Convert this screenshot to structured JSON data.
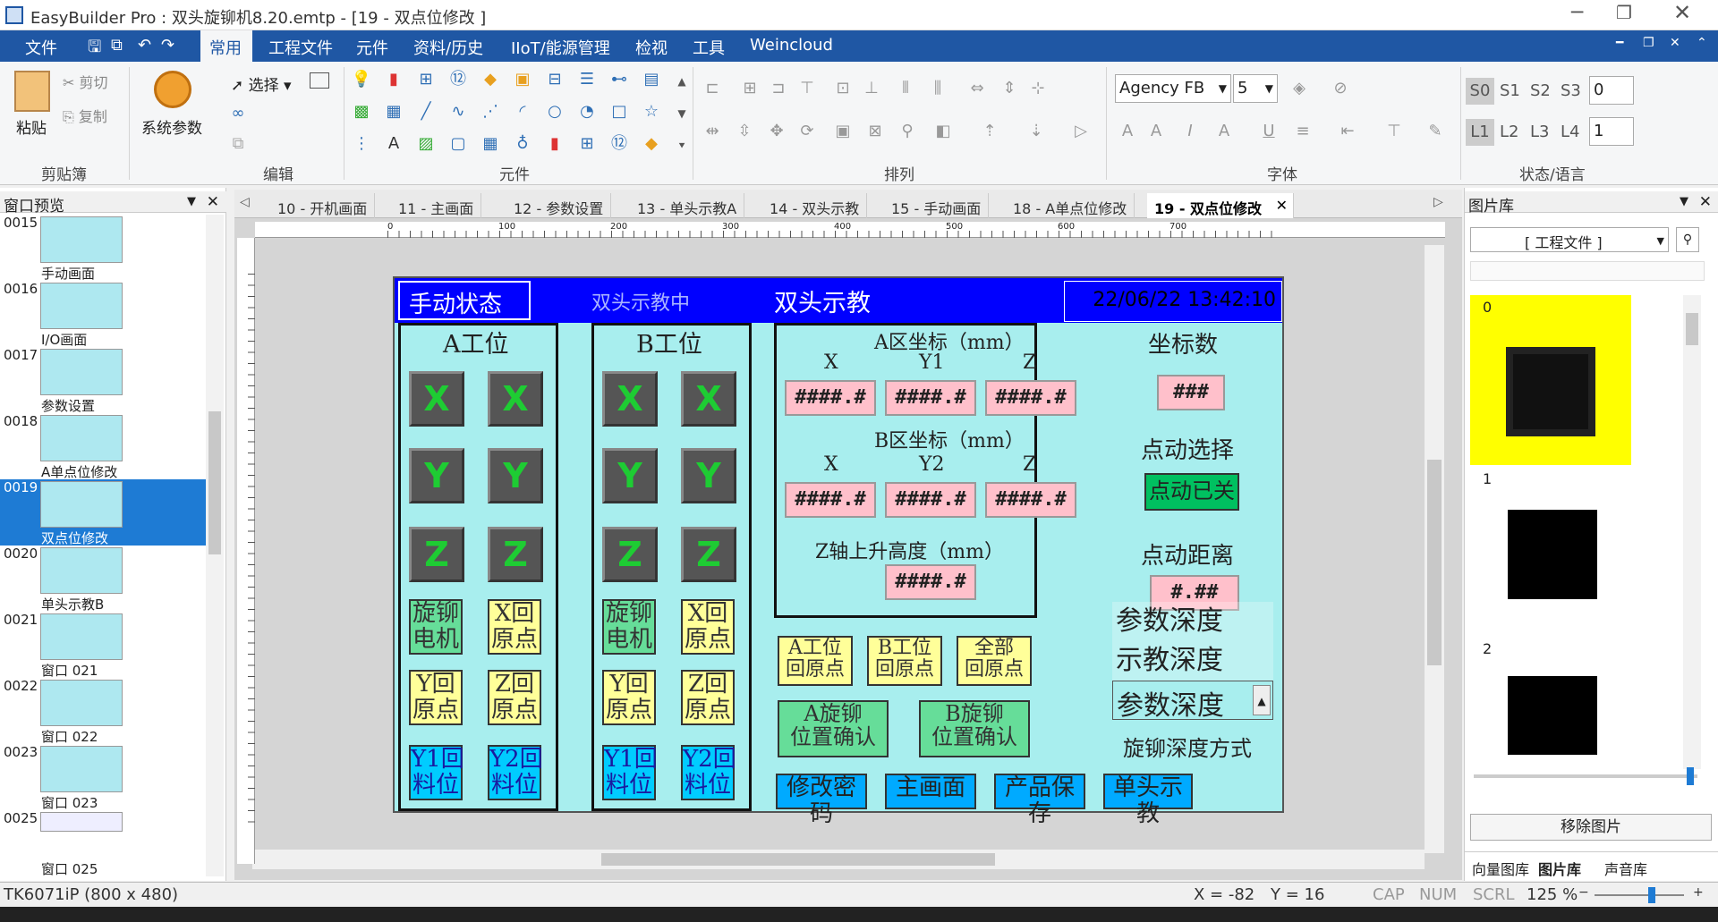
{
  "window": {
    "title": "EasyBuilder Pro : 双头旋铆机8.20.emtp - [19 - 双点位修改 ]"
  },
  "menu": {
    "file": "文件",
    "items": [
      "常用",
      "工程文件",
      "元件",
      "资料/历史",
      "IIoT/能源管理",
      "检视",
      "工具",
      "Weincloud"
    ]
  },
  "ribbon": {
    "clipboard": {
      "paste": "粘贴",
      "cut": "剪切",
      "copy": "复制",
      "group": "剪贴簿"
    },
    "edit": {
      "sysparam": "系统参数",
      "select": "选择",
      "group": "编辑"
    },
    "elements": {
      "group": "元件"
    },
    "arrange": {
      "group": "排列"
    },
    "font": {
      "family": "Agency FB",
      "size": "5",
      "group": "字体"
    },
    "state": {
      "s": [
        "S0",
        "S1",
        "S2",
        "S3"
      ],
      "s_val": "0",
      "l": [
        "L1",
        "L2",
        "L3",
        "L4"
      ],
      "l_val": "1",
      "group": "状态/语言"
    }
  },
  "left_panel": {
    "title": "窗口预览",
    "items": [
      {
        "num": "0015",
        "label": "手动画面"
      },
      {
        "num": "0016",
        "label": "I/O画面"
      },
      {
        "num": "0017",
        "label": "参数设置"
      },
      {
        "num": "0018",
        "label": "A单点位修改"
      },
      {
        "num": "0019",
        "label": "双点位修改"
      },
      {
        "num": "0020",
        "label": "单头示教B"
      },
      {
        "num": "0021",
        "label": "窗口 021"
      },
      {
        "num": "0022",
        "label": "窗口 022"
      },
      {
        "num": "0023",
        "label": "窗口 023"
      },
      {
        "num": "0025",
        "label": "窗口 025"
      }
    ]
  },
  "tabs": [
    "10 - 开机画面",
    "11 - 主画面",
    "12 - 参数设置",
    "13 - 单头示教A",
    "14 - 双头示教",
    "15 - 手动画面",
    "18 - A单点位修改",
    "19 - 双点位修改"
  ],
  "ruler": {
    "marks": [
      "0",
      "100",
      "200",
      "300",
      "400",
      "500",
      "600",
      "700"
    ]
  },
  "hmi": {
    "header": {
      "state": "手动状态",
      "teaching": "双头示教中",
      "title": "双头示教",
      "datetime": "22/06/22 13:42:10"
    },
    "stationA": "A工位",
    "stationB": "B工位",
    "axes": [
      "X",
      "X",
      "Y",
      "Y",
      "Z",
      "Z"
    ],
    "btnA": [
      [
        "旋铆\n电机",
        "X回\n原点"
      ],
      [
        "Y回\n原点",
        "Z回\n原点"
      ],
      [
        "Y1回\n料位",
        "Y2回\n料位"
      ]
    ],
    "btnB": [
      [
        "旋铆\n电机",
        "X回\n原点"
      ],
      [
        "Y回\n原点",
        "Z回\n原点"
      ],
      [
        "Y1回\n料位",
        "Y2回\n料位"
      ]
    ],
    "coordA": "A区坐标（mm）",
    "coordB": "B区坐标（mm）",
    "colsA": [
      "X",
      "Y1",
      "Z"
    ],
    "colsB": [
      "X",
      "Y2",
      "Z"
    ],
    "numfmt": "####.#",
    "zlift": "Z轴上升高度（mm）",
    "coordnum_label": "坐标数",
    "coordnum": "###",
    "jogsel_label": "点动选择",
    "jog_off": "点动已关",
    "jogdist_label": "点动距离",
    "jogdist": "#.##",
    "list": [
      "参数深度",
      "示教深度"
    ],
    "list_sel": "参数深度",
    "depth_mode": "旋铆深度方式",
    "home_btns": [
      "A工位\n回原点",
      "B工位\n回原点",
      "全部\n回原点"
    ],
    "confirm_btns": [
      "A旋铆\n位置确认",
      "B旋铆\n位置确认"
    ],
    "bottom_btns": [
      "修改密码",
      "主画面",
      "产品保存",
      "单头示教"
    ]
  },
  "right_panel": {
    "title": "图片库",
    "combo": "[ 工程文件 ]",
    "items": [
      "0",
      "1",
      "2"
    ],
    "remove": "移除图片",
    "tabs": [
      "向量图库",
      "图片库",
      "声音库"
    ]
  },
  "status": {
    "device": "TK6071iP (800 x 480)",
    "x": "X = -82",
    "y": "Y = 16",
    "cap": "CAP",
    "num": "NUM",
    "scrl": "SCRL",
    "zoom": "125 %"
  }
}
